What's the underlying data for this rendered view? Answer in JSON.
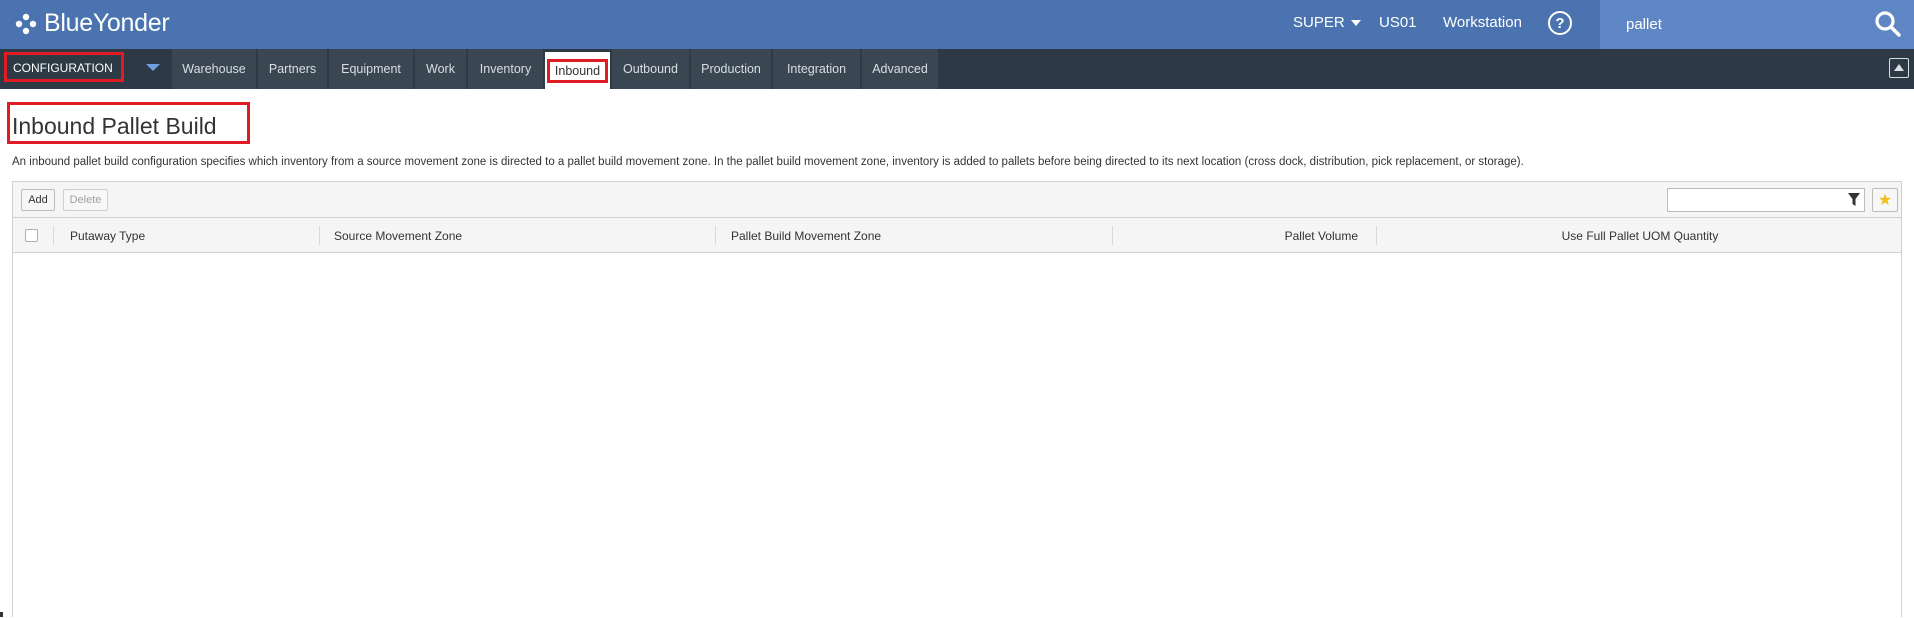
{
  "header": {
    "brand": "BlueYonder",
    "user": "SUPER",
    "warehouse": "US01",
    "workstation": "Workstation",
    "help_icon": "question-circle-icon",
    "search": {
      "value": "pallet",
      "icon": "search-icon"
    }
  },
  "nav": {
    "module": "CONFIGURATION",
    "tabs": [
      {
        "label": "Warehouse"
      },
      {
        "label": "Partners"
      },
      {
        "label": "Equipment"
      },
      {
        "label": "Work"
      },
      {
        "label": "Inventory"
      },
      {
        "label": "Inbound",
        "active": true
      },
      {
        "label": "Outbound"
      },
      {
        "label": "Production"
      },
      {
        "label": "Integration"
      },
      {
        "label": "Advanced"
      }
    ]
  },
  "page": {
    "title": "Inbound Pallet Build",
    "description": "An inbound pallet build configuration specifies which inventory from a source movement zone is directed to a pallet build movement zone. In the pallet build movement zone, inventory is added to pallets before being directed to its next location (cross dock, distribution, pick replacement, or storage)."
  },
  "grid": {
    "add_label": "Add",
    "delete_label": "Delete",
    "filter_value": "",
    "columns": [
      "Putaway Type",
      "Source Movement Zone",
      "Pallet Build Movement Zone",
      "Pallet Volume",
      "Use Full Pallet UOM Quantity"
    ],
    "rows": []
  },
  "colors": {
    "header_bg": "#4a73b0",
    "search_bg": "#5f86c4",
    "nav_bg": "#2d3a45",
    "tab_bg": "#3a4753",
    "highlight": "#e01b24"
  }
}
